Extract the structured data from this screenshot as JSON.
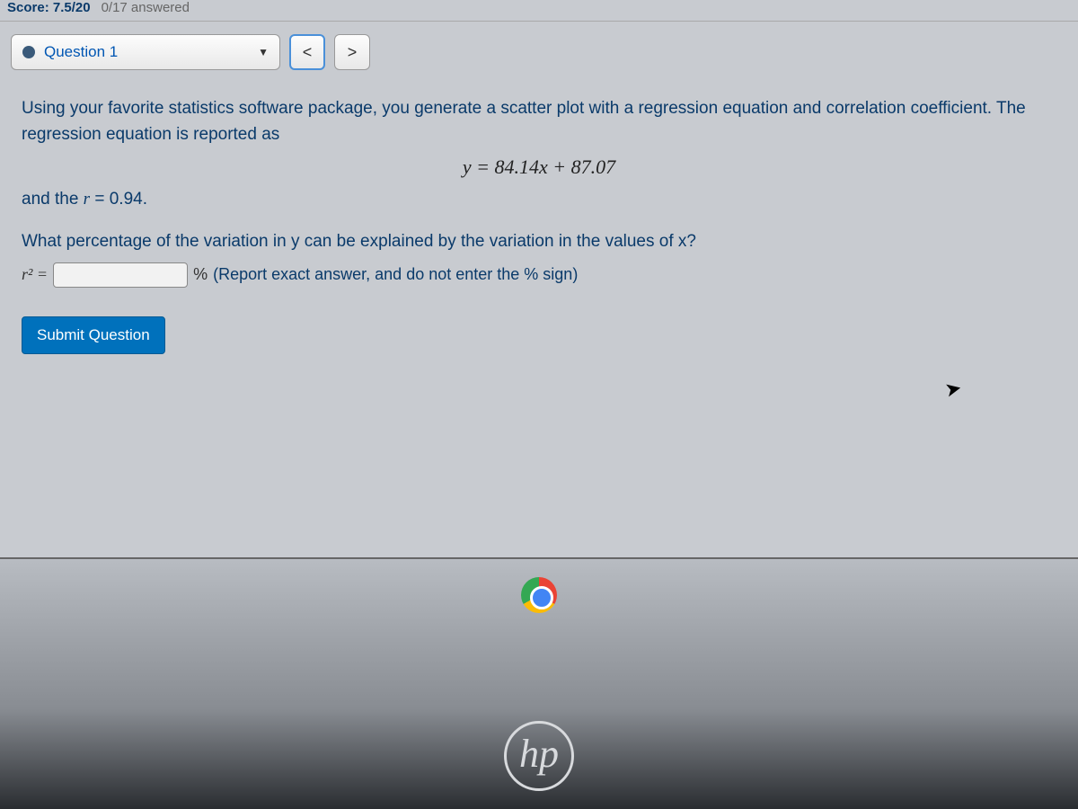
{
  "header": {
    "score_label": "Score: 7.5/20",
    "answered_label": "0/17 answered"
  },
  "nav": {
    "question_label": "Question 1",
    "prev_symbol": "<",
    "next_symbol": ">"
  },
  "question": {
    "intro": "Using your favorite statistics software package, you generate a scatter plot with a regression equation and correlation coefficient. The regression equation is reported as",
    "equation": "y = 84.14x + 87.07",
    "r_prefix": "and the ",
    "r_var": "r",
    "r_equals": " = 0.94.",
    "sub_q": "What percentage of the variation in y can be explained by the variation in the values of x?",
    "r2_label": "r² =",
    "pct_symbol": "%",
    "hint": "(Report exact answer, and do not enter the % sign)",
    "submit_label": "Submit Question"
  },
  "footer": {
    "hp_text": "hp"
  }
}
